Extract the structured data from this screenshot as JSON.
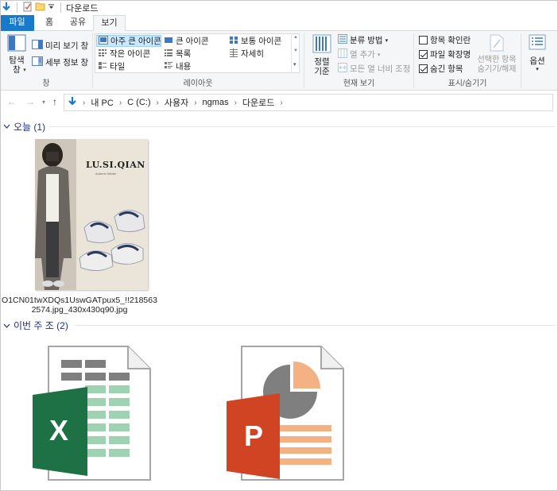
{
  "window": {
    "title": "다운로드"
  },
  "tabs": {
    "file": "파일",
    "home": "홈",
    "share": "공유",
    "view": "보기"
  },
  "ribbon": {
    "panes": {
      "navigation_pane": "탐색\n창",
      "preview_pane": "미리 보기 창",
      "details_pane": "세부 정보 창",
      "group_label": "창"
    },
    "layout": {
      "extra_large_icons": "아주 큰 아이콘",
      "large_icons": "큰 아이콘",
      "medium_icons": "보통 아이콘",
      "small_icons": "작은 아이콘",
      "list": "목록",
      "details": "자세히",
      "tiles": "타일",
      "content": "내용",
      "group_label": "레이아웃"
    },
    "current_view": {
      "sort_by": "정렬\n기준",
      "group_by": "분류 방법",
      "add_columns": "열 추가",
      "size_all_columns": "모든 열 너비 조정",
      "group_label": "현재 보기"
    },
    "show_hide": {
      "item_check_boxes": "항목 확인란",
      "item_check_boxes_checked": false,
      "file_name_extensions": "파일 확장명",
      "file_name_extensions_checked": true,
      "hidden_items": "숨긴 항목",
      "hidden_items_checked": true,
      "hide_selected_items": "선택한 항목\n숨기기/해제",
      "group_label": "표시/숨기기"
    },
    "options": {
      "label": "옵션"
    }
  },
  "address": {
    "crumbs": [
      "내 PC",
      "C (C:)",
      "사용자",
      "ngmas",
      "다운로드"
    ]
  },
  "groups": [
    {
      "header": "오늘 (1)"
    },
    {
      "header": "이번 주 조 (2)"
    }
  ],
  "files": {
    "image": {
      "name": "O1CN01twXDQs1UswGATpux5_!!2185632574.jpg_430x430q90.jpg",
      "brand_text": "LU.SI.QIAN",
      "brand_sub": "Autumn Winter"
    },
    "excel": {
      "letter": "X"
    },
    "powerpoint": {
      "letter": "P"
    }
  },
  "colors": {
    "accent": "#1979ca",
    "excel": "#1e7145",
    "excel_cells": "#9dd3b0",
    "ppt": "#d04423",
    "ppt_lines": "#f4b183",
    "group_header": "#1e3287"
  }
}
